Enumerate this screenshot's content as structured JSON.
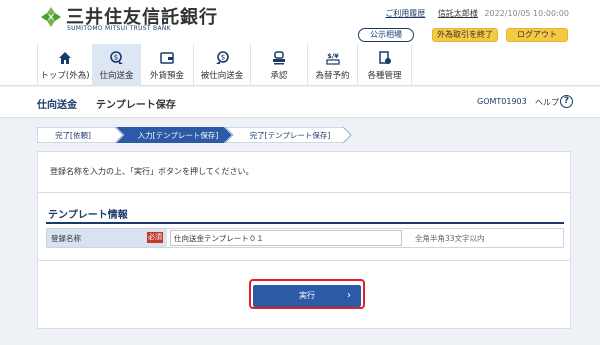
{
  "header": {
    "bank_name": "三井住友信託銀行",
    "bank_name_en": "SUMITOMO MITSUI TRUST BANK",
    "links": {
      "history": "ご利用履歴",
      "user": "信託太郎様",
      "timestamp": "2022/10/05 10:00:00"
    },
    "buttons": {
      "cert": "公示相場",
      "fx_end": "外為取引を終了",
      "logout": "ログアウト"
    }
  },
  "nav": {
    "items": [
      {
        "label": "トップ(外為)",
        "icon": "home-icon"
      },
      {
        "label": "仕向送金",
        "icon": "remit-outbound-icon"
      },
      {
        "label": "外貨預金",
        "icon": "fx-deposit-icon"
      },
      {
        "label": "被仕向送金",
        "icon": "remit-inbound-icon"
      },
      {
        "label": "承認",
        "icon": "approval-icon"
      },
      {
        "label": "為替予約",
        "icon": "fx-contract-icon"
      },
      {
        "label": "各種管理",
        "icon": "management-icon"
      }
    ],
    "active": "仕向送金"
  },
  "page": {
    "category": "仕向送金",
    "title": "テンプレート保存",
    "screen_code": "GOMT01903",
    "help": "ヘルプ"
  },
  "steps": [
    {
      "label": "完了[依頼]",
      "state": "done"
    },
    {
      "label": "入力[テンプレート保存]",
      "state": "current"
    },
    {
      "label": "完了[テンプレート保存]",
      "state": "todo"
    }
  ],
  "content": {
    "instruction": "登録名称を入力の上、「実行」ボタンを押してください。",
    "section_title": "テンプレート情報",
    "form": {
      "label": "登録名称",
      "required": "必須",
      "value": "仕向送金テンプレート０１",
      "hint": "全角半角33文字以内"
    },
    "execute": "実行"
  },
  "colors": {
    "navy": "#1a3a6b",
    "accent_blue": "#2d5aa6",
    "highlight_red": "#e0202a",
    "yellow": "#f5c845"
  }
}
